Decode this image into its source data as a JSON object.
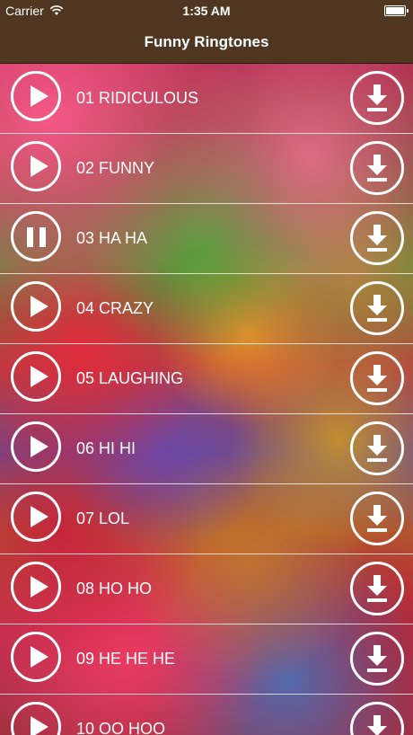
{
  "status": {
    "carrier": "Carrier",
    "time": "1:35 AM"
  },
  "nav": {
    "title": "Funny Ringtones"
  },
  "rows": [
    {
      "label": "01 RIDICULOUS",
      "state": "play"
    },
    {
      "label": "02 FUNNY",
      "state": "play"
    },
    {
      "label": "03 HA HA",
      "state": "pause"
    },
    {
      "label": "04 CRAZY",
      "state": "play"
    },
    {
      "label": "05 LAUGHING",
      "state": "play"
    },
    {
      "label": "06 HI HI",
      "state": "play"
    },
    {
      "label": "07 LOL",
      "state": "play"
    },
    {
      "label": "08 HO HO",
      "state": "play"
    },
    {
      "label": "09 HE HE HE",
      "state": "play"
    },
    {
      "label": "10 OO HOO",
      "state": "play"
    }
  ],
  "icons": {
    "play": "play-icon",
    "pause": "pause-icon",
    "download": "download-icon",
    "wifi": "wifi-icon",
    "battery": "battery-icon"
  },
  "colors": {
    "bar_background": "#4e3620",
    "foreground": "#ffffff"
  }
}
